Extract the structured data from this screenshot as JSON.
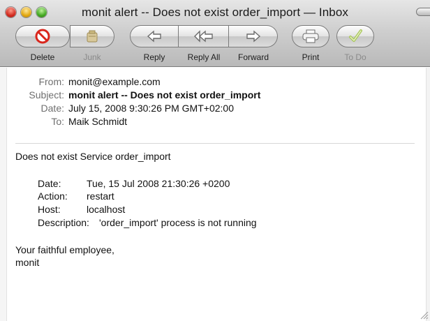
{
  "window": {
    "title": "monit alert --  Does not exist order_import — Inbox"
  },
  "toolbar": {
    "buttons": [
      {
        "label": "Delete",
        "icon": "no-entry-icon",
        "enabled": true
      },
      {
        "label": "Junk",
        "icon": "junk-bag-icon",
        "enabled": false
      },
      {
        "label": "Reply",
        "icon": "reply-arrow-icon",
        "enabled": true
      },
      {
        "label": "Reply All",
        "icon": "reply-all-arrow-icon",
        "enabled": true
      },
      {
        "label": "Forward",
        "icon": "forward-arrow-icon",
        "enabled": true
      },
      {
        "label": "Print",
        "icon": "printer-icon",
        "enabled": true
      },
      {
        "label": "To Do",
        "icon": "checkmark-icon",
        "enabled": false
      }
    ]
  },
  "headers": {
    "from_label": "From:",
    "from_value": "monit@example.com",
    "subject_label": "Subject:",
    "subject_value": "monit alert --  Does not exist order_import",
    "date_label": "Date:",
    "date_value": "July 15, 2008 9:30:26 PM GMT+02:00",
    "to_label": "To:",
    "to_value": "Maik Schmidt"
  },
  "body": {
    "intro": "Does not exist Service order_import",
    "details": [
      {
        "label": "Date:",
        "value": "Tue, 15 Jul 2008 21:30:26 +0200"
      },
      {
        "label": "Action:",
        "value": "restart"
      },
      {
        "label": "Host:",
        "value": "localhost"
      },
      {
        "label": "Description:",
        "value": "'order_import' process is not running"
      }
    ],
    "closing": "Your faithful employee,",
    "signature": "monit"
  },
  "colors": {
    "header_label": "#6f6f6f",
    "delete_red": "#d9261c",
    "todo_green": "#8fbf2a"
  }
}
